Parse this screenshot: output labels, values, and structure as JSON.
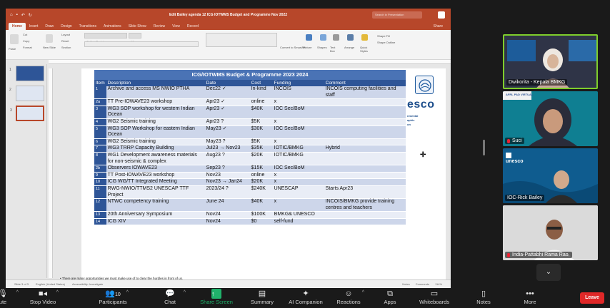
{
  "ppt": {
    "doc_title": "Edit Bailey agenda 12 ICG IOTWMS Budget and Programme Nov 2022",
    "search_placeholder": "Search in Presentation",
    "tabs": [
      "Home",
      "Insert",
      "Draw",
      "Design",
      "Transitions",
      "Animations",
      "Slide Show",
      "Review",
      "View",
      "Record"
    ],
    "share_label": "Share",
    "ribbon_labels": {
      "paste": "Paste",
      "cut": "Cut",
      "copy": "Copy",
      "format": "Format",
      "new_slide": "New Slide",
      "layout": "Layout",
      "reset": "Reset",
      "section": "Section",
      "convert": "Convert to SmartArt",
      "picture": "Picture",
      "shapes": "Shapes",
      "text_box": "Text Box",
      "arrange": "Arrange",
      "quick_styles": "Quick Styles",
      "shape_fill": "Shape Fill",
      "shape_outline": "Shape Outline",
      "font_name": "Calibri (Body)",
      "font_size": "18"
    },
    "thumb_numbers": [
      "1",
      "2",
      "3"
    ],
    "status": {
      "slide": "Slide 3 of 3",
      "lang": "English (United States)",
      "access": "Accessibility: Investigate",
      "notes": "Notes",
      "comments": "Comments",
      "zoom": "114%"
    }
  },
  "slide": {
    "title": "ICG/IOTWMS Budget & Programme 2023 2024",
    "columns": [
      "Item",
      "Description",
      "Date",
      "Cost",
      "Funding",
      "Comment"
    ],
    "rows": [
      {
        "item": "1",
        "desc": "Archive and access MS NWIO PTHA",
        "date": "Dec22 ✓",
        "cost": "In-kind",
        "fund": "INCOIS",
        "comment": "INCOIS computing facilities and staff"
      },
      {
        "item": "2a",
        "desc": "TT Pre-IOWAVE23 workshop",
        "date": "Apr23 ✓",
        "cost": "online",
        "fund": "x",
        "comment": ""
      },
      {
        "item": "3",
        "desc": "WG3 SOP workshop for western Indian Ocean",
        "date": "Apr23 ✓",
        "cost": "$40K",
        "fund": "IOC Sec/BoM",
        "comment": ""
      },
      {
        "item": "4",
        "desc": "WG2 Seismic training",
        "date": "Apr23 ?",
        "cost": "$5K",
        "fund": "x",
        "comment": ""
      },
      {
        "item": "5",
        "desc": "WG3 SOP Workshop for eastern Indian Ocean",
        "date": "May23 ✓",
        "cost": "$30K",
        "fund": "IOC Sec/BoM",
        "comment": ""
      },
      {
        "item": "6",
        "desc": "WG2 Seismic training",
        "date": "May23 ?",
        "cost": "$5K",
        "fund": "x",
        "comment": ""
      },
      {
        "item": "7",
        "desc": "WG3 TRRP Capacity Building",
        "date": "Jul23 → Nov23",
        "cost": "$35K",
        "fund": "IOTIC/BMKG",
        "comment": "Hybrid"
      },
      {
        "item": "8",
        "desc": "WG1 Development awareness materials for non-seismic & complex",
        "date": "Aug23 ?",
        "cost": "$20K",
        "fund": "IOTIC/BMKG",
        "comment": ""
      },
      {
        "item": "2b",
        "desc": "Observers IOWAVE23",
        "date": "Sep23 ?",
        "cost": "$15K",
        "fund": "IOC Sec/BoM",
        "comment": ""
      },
      {
        "item": "9",
        "desc": "TT Post-IOWAVE23 workshop",
        "date": "Nov23",
        "cost": "online",
        "fund": "x",
        "comment": ""
      },
      {
        "item": "10",
        "desc": "ICG WG/TT Integrated Meeting",
        "date": "Nov23 → Jan24",
        "cost": "$20K",
        "fund": "x",
        "comment": ""
      },
      {
        "item": "11",
        "desc": "RWG-NWIO/TTMS2 UNESCAP TTF Project",
        "date": "2023/24 ?",
        "cost": "$240K",
        "fund": "UNESCAP",
        "comment": "Starts Apr23"
      },
      {
        "item": "12",
        "desc": "NTWC competency training",
        "date": "June 24",
        "cost": "$40K",
        "fund": "x",
        "comment": "INCOIS/BMKG provide training centres and teachers"
      },
      {
        "item": "13",
        "desc": "20th Anniversary Symposium",
        "date": "Nov24",
        "cost": "$100K",
        "fund": "BMKG& UNESCO",
        "comment": ""
      },
      {
        "item": "14",
        "desc": "ICG XIV",
        "date": "Nov24",
        "cost": "$0",
        "fund": "self-fund",
        "comment": ""
      }
    ],
    "logo_word": "esco",
    "logo_sub": [
      "nmental",
      "aphic",
      "on"
    ],
    "notes": [
      "There are many opportunities we must make use of to clear the hurdles in front of us.",
      "One of the most important opportunities is the Tsunami Programme component of the United Nations Ocean Decade"
    ]
  },
  "participants": [
    {
      "name": "Dwikorita - Kepala BMKG",
      "muted": false,
      "active": true
    },
    {
      "name": "Suci",
      "muted": true,
      "active": false
    },
    {
      "name": "IOC-Rick Bailey",
      "muted": false,
      "active": false
    },
    {
      "name": "India-Pattabhi Rama Rao.",
      "muted": true,
      "active": false
    }
  ],
  "tile_badges": {
    "tile2": "AFRL PAD VIRTUAL",
    "tile3": "unesco"
  },
  "toolbar": {
    "mute": "ute",
    "stop_video": "Stop Video",
    "participants": "Participants",
    "participants_count": "10",
    "chat": "Chat",
    "share_screen": "Share Screen",
    "summary": "Summary",
    "ai_companion": "AI Companion",
    "reactions": "Reactions",
    "apps": "Apps",
    "whiteboards": "Whiteboards",
    "notes": "Notes",
    "more": "More",
    "leave": "Leave"
  },
  "colors": {
    "ppt_red": "#b7472a",
    "table_header": "#2e5597",
    "share_green": "#20b26b",
    "leave_red": "#e02828",
    "active_speaker": "#7fce2b"
  }
}
